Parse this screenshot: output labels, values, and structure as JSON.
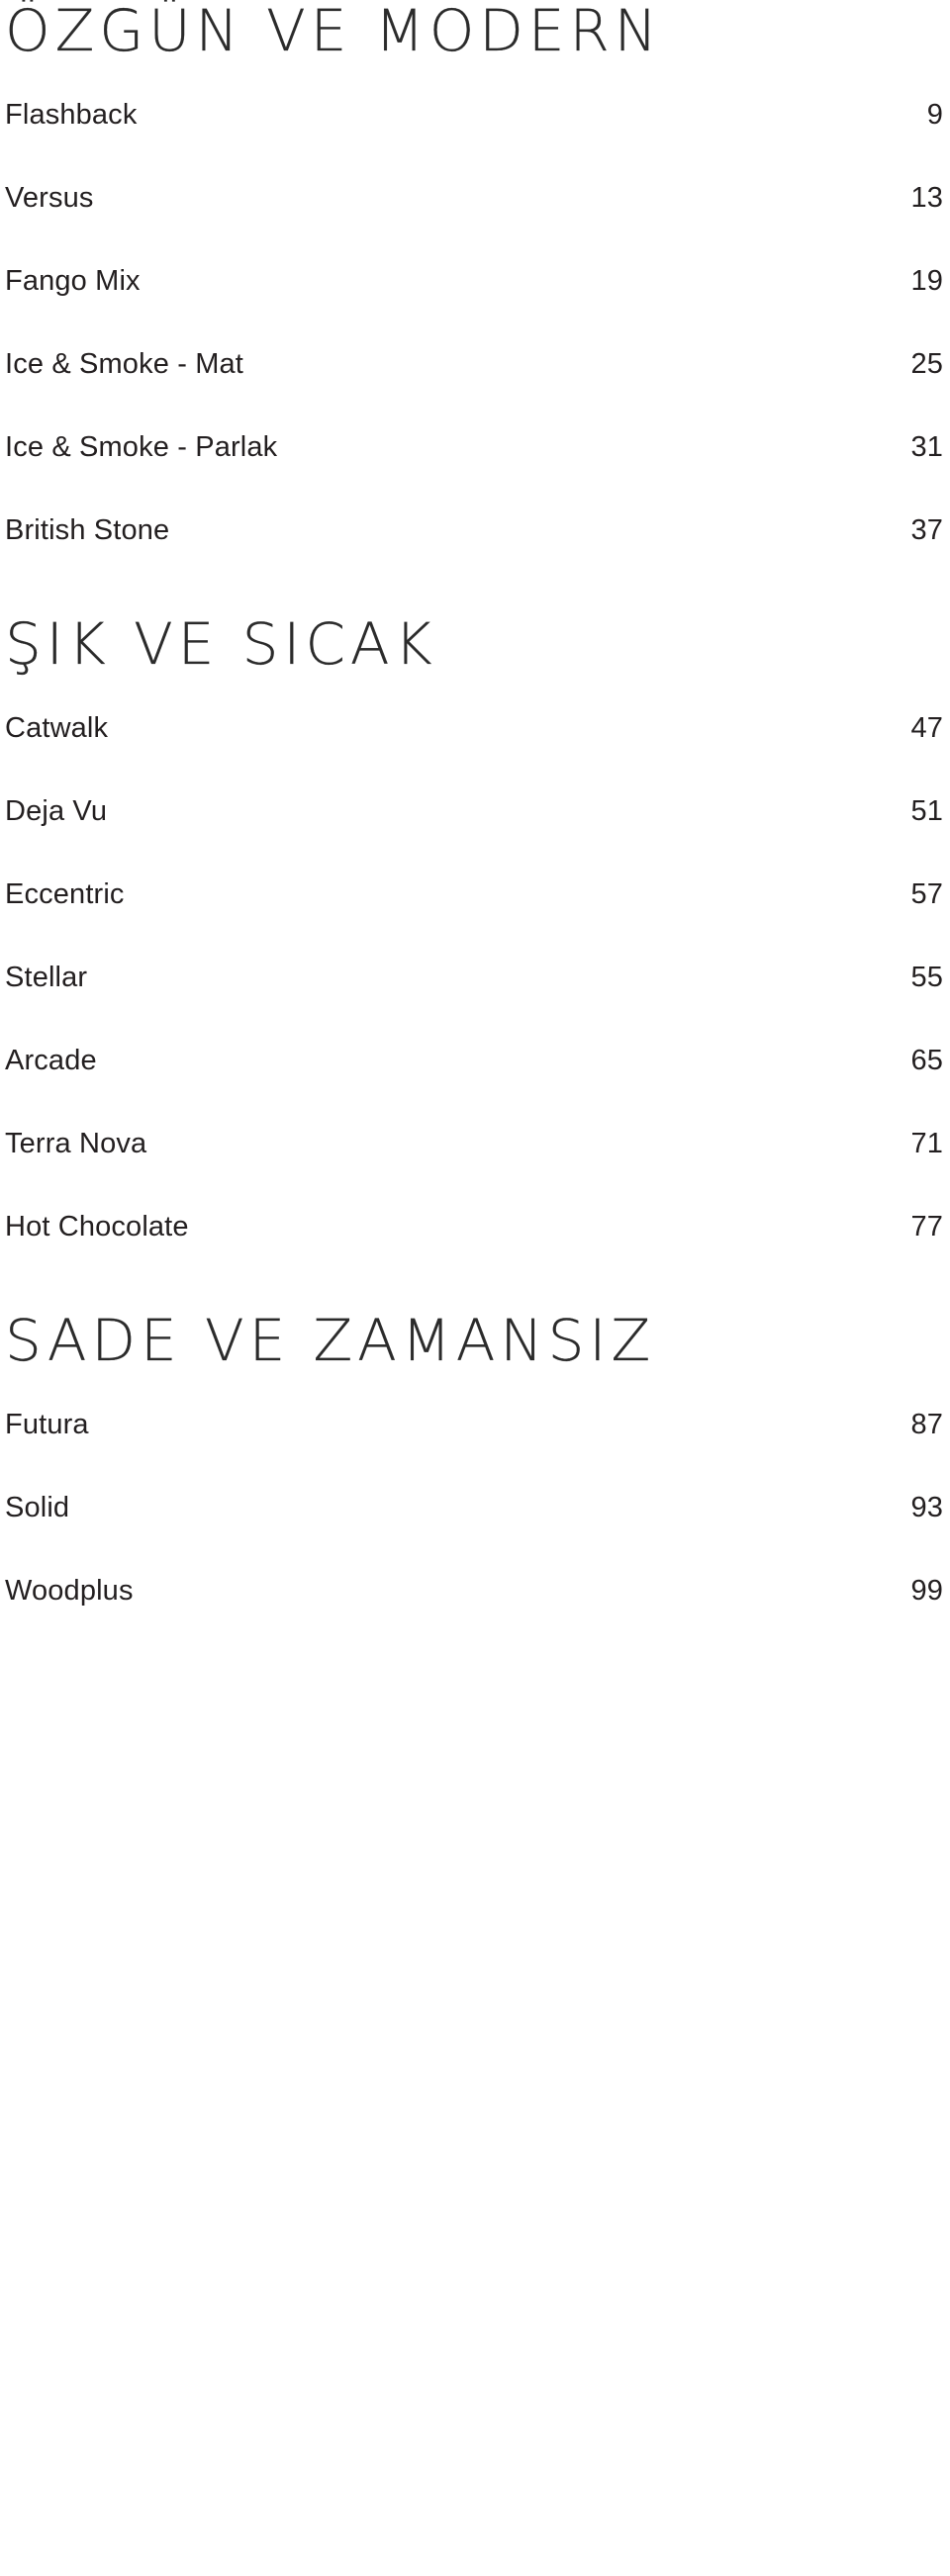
{
  "document": {
    "type": "table-of-contents",
    "text_color": "#231f20",
    "background_color": "#ffffff",
    "heading_color": "#2b2b2b"
  },
  "sections": [
    {
      "heading": "ÖZGÜN VE MODERN",
      "entries": [
        {
          "title": "Flashback",
          "page": "9"
        },
        {
          "title": "Versus",
          "page": "13"
        },
        {
          "title": "Fango Mix",
          "page": "19"
        },
        {
          "title": "Ice & Smoke - Mat",
          "page": "25"
        },
        {
          "title": "Ice & Smoke - Parlak",
          "page": "31"
        },
        {
          "title": "British Stone",
          "page": "37"
        }
      ]
    },
    {
      "heading": "ŞIK VE SICAK",
      "entries": [
        {
          "title": "Catwalk",
          "page": "47"
        },
        {
          "title": "Deja Vu",
          "page": "51"
        },
        {
          "title": "Eccentric",
          "page": "57"
        },
        {
          "title": "Stellar",
          "page": "55"
        },
        {
          "title": "Arcade",
          "page": "65"
        },
        {
          "title": "Terra Nova",
          "page": "71"
        },
        {
          "title": "Hot Chocolate",
          "page": "77"
        }
      ]
    },
    {
      "heading": "SADE VE ZAMANSIZ",
      "entries": [
        {
          "title": "Futura",
          "page": "87"
        },
        {
          "title": "Solid",
          "page": "93"
        },
        {
          "title": "Woodplus",
          "page": "99"
        }
      ]
    }
  ]
}
